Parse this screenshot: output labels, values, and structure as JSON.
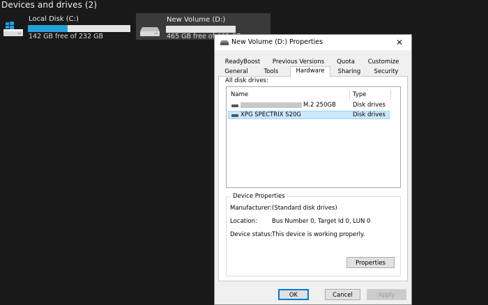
{
  "explorer": {
    "section_title": "Devices and drives (2)",
    "drives": [
      {
        "name": "Local Disk (C:)",
        "free_text": "142 GB free of 232 GB",
        "used_fraction": 0.39,
        "icon": "windows-drive-icon"
      },
      {
        "name": "New Volume (D:)",
        "free_text": "465 GB free of 465 GB",
        "used_fraction": 0.0,
        "icon": "hard-drive-icon"
      }
    ]
  },
  "dialog": {
    "title": "New Volume (D:) Properties",
    "close_glyph": "✕",
    "tabs_row1": [
      "ReadyBoost",
      "Previous Versions",
      "Quota",
      "Customize"
    ],
    "tabs_row2": [
      "General",
      "Tools",
      "Hardware",
      "Sharing",
      "Security"
    ],
    "active_tab": "Hardware",
    "all_disk_drives_label": "All disk drives:",
    "columns": {
      "name": "Name",
      "type": "Type"
    },
    "drives": [
      {
        "name": "M.2 250GB",
        "type": "Disk drives",
        "selected": false,
        "name_prefix_redacted": true
      },
      {
        "name": "XPG SPECTRIX S20G",
        "type": "Disk drives",
        "selected": true,
        "name_prefix_redacted": false
      }
    ],
    "device_properties": {
      "title": "Device Properties",
      "manufacturer_label": "Manufacturer:",
      "manufacturer_value": "(Standard disk drives)",
      "location_label": "Location:",
      "location_value": "Bus Number 0, Target Id 0, LUN 0",
      "status_label": "Device status:",
      "status_value": "This device is working properly.",
      "properties_button": "Properties"
    },
    "buttons": {
      "ok": "OK",
      "cancel": "Cancel",
      "apply": "Apply"
    }
  },
  "colors": {
    "accent": "#26a0da",
    "selection": "#cce8ff",
    "background": "#191919"
  }
}
